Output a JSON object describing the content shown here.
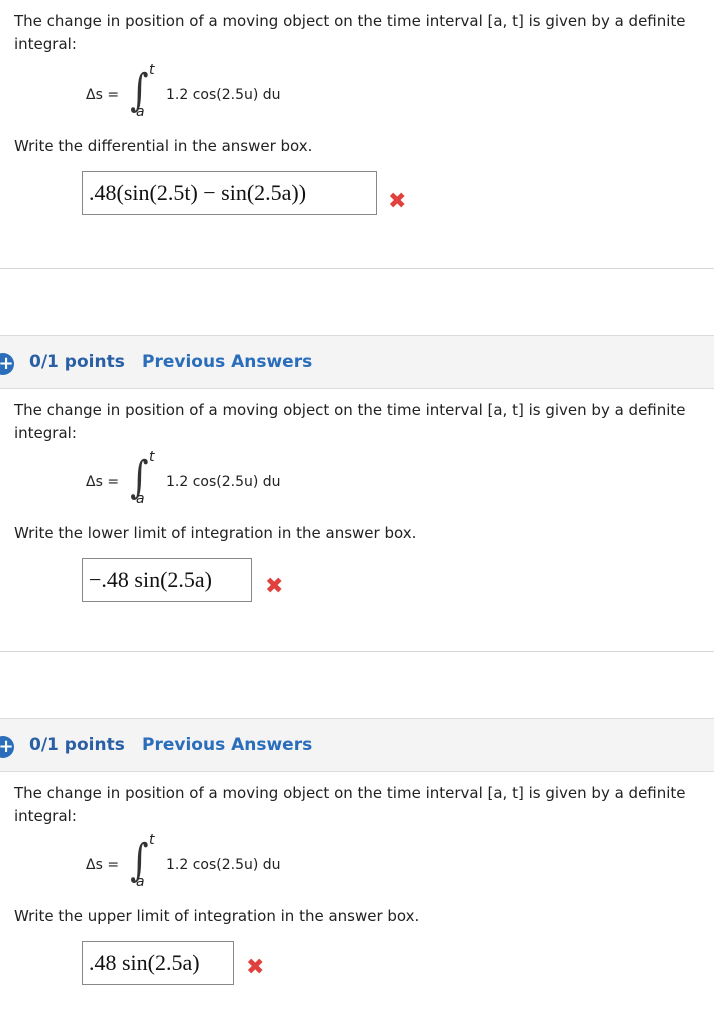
{
  "questions": [
    {
      "intro": "The change in position of a moving object on the time interval [a, t] is given by a definite integral:",
      "formula": {
        "lhs": "Δs =",
        "upper": "t",
        "lower": "a",
        "integrand": "1.2 cos(2.5u) du"
      },
      "prompt": "Write the differential in the answer box.",
      "answer": ".48(sin(2.5t) − sin(2.5a))",
      "result_mark": "✖"
    },
    {
      "points": "0/1 points",
      "previous_answers": "Previous Answers",
      "intro": "The change in position of a moving object on the time interval [a, t] is given by a definite integral:",
      "formula": {
        "lhs": "Δs =",
        "upper": "t",
        "lower": "a",
        "integrand": "1.2 cos(2.5u) du"
      },
      "prompt": "Write the lower limit of integration in the answer box.",
      "answer": "−.48 sin(2.5a)",
      "result_mark": "✖"
    },
    {
      "points": "0/1 points",
      "previous_answers": "Previous Answers",
      "intro": "The change in position of a moving object on the time interval [a, t] is given by a definite integral:",
      "formula": {
        "lhs": "Δs =",
        "upper": "t",
        "lower": "a",
        "integrand": "1.2 cos(2.5u) du"
      },
      "prompt": "Write the upper limit of integration in the answer box.",
      "answer": ".48 sin(2.5a)",
      "result_mark": "✖"
    }
  ],
  "icons": {
    "expand": "plus-circle-icon",
    "incorrect": "x-mark-icon"
  },
  "colors": {
    "link": "#2a6ebb",
    "incorrect": "#e0413c",
    "header_bg": "#f4f4f4"
  }
}
